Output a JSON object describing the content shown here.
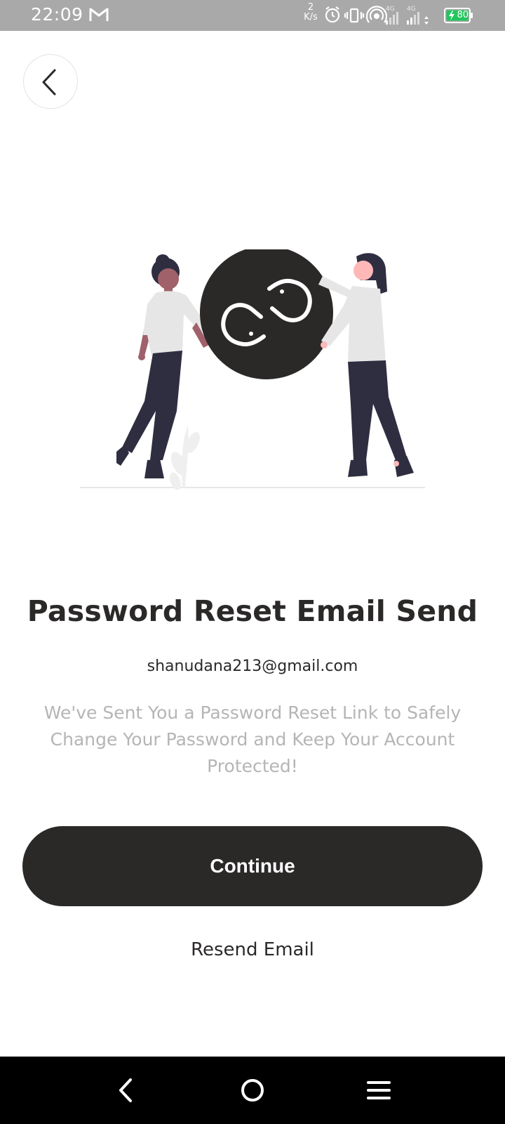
{
  "status_bar": {
    "time": "22:09",
    "network_speed_value": "2",
    "network_speed_unit": "K/s",
    "signal_1_label": "4G",
    "signal_2_label": "4G",
    "battery_level": "80",
    "icons": [
      "gmail-icon",
      "alarm-icon",
      "vibrate-icon",
      "hotspot-icon",
      "signal-icon",
      "signal-icon",
      "battery-charging-icon"
    ]
  },
  "header": {
    "back_icon": "chevron-left-icon"
  },
  "illustration": {
    "icon": "link-icon"
  },
  "content": {
    "title": "Password Reset Email Send",
    "email": "shanudana213@gmail.com",
    "description": "We've Sent You a Password Reset Link to Safely Change Your Password and Keep Your Account Protected!"
  },
  "actions": {
    "continue_label": "Continue",
    "resend_label": "Resend Email"
  },
  "nav_bar": {
    "icons": [
      "nav-back-icon",
      "nav-home-icon",
      "nav-recents-icon"
    ]
  },
  "colors": {
    "primary_dark": "#2b2828",
    "muted_text": "#b5b5b5",
    "status_bar_bg": "#a9a9a9",
    "battery_green": "#22c55e"
  }
}
